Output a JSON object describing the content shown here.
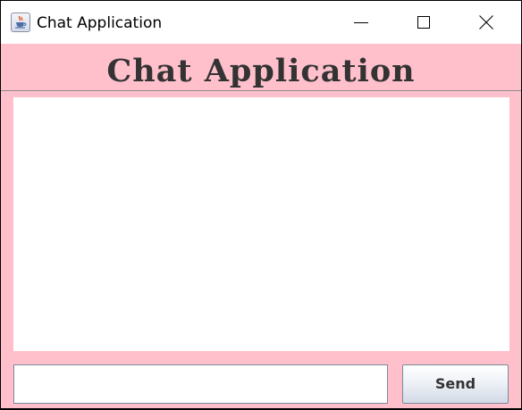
{
  "window": {
    "title": "Chat Application",
    "icon": "java-coffee-cup-icon",
    "controls": [
      "minimize-icon",
      "maximize-icon",
      "close-icon"
    ]
  },
  "header": {
    "title": "Chat Application"
  },
  "chat": {
    "messages": "",
    "input_value": "",
    "send_label": "Send"
  },
  "colors": {
    "background": "#ffc0cb",
    "heading_text": "#333333",
    "panel": "#ffffff"
  }
}
